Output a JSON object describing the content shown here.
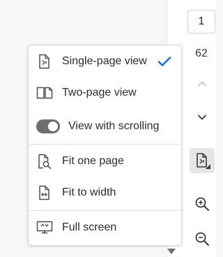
{
  "toolbar": {
    "current_page": "1",
    "total_pages": "62",
    "icons": [
      "chevron-up-icon",
      "chevron-down-icon",
      "page-display-icon",
      "zoom-in-icon",
      "zoom-out-icon"
    ]
  },
  "view_menu": {
    "items": [
      {
        "label": "Single-page view",
        "icon": "single-page-icon",
        "checked": true
      },
      {
        "label": "Two-page view",
        "icon": "two-page-icon"
      },
      {
        "label": "View with scrolling",
        "icon": "toggle-switch",
        "toggle_on": true
      },
      {
        "label": "Fit one page",
        "icon": "fit-page-icon"
      },
      {
        "label": "Fit to width",
        "icon": "fit-width-icon"
      },
      {
        "label": "Full screen",
        "icon": "full-screen-icon"
      }
    ]
  },
  "colors": {
    "accent": "#1473e6",
    "icon": "#4b4b4b",
    "toggle_track": "#6e6e6e"
  }
}
